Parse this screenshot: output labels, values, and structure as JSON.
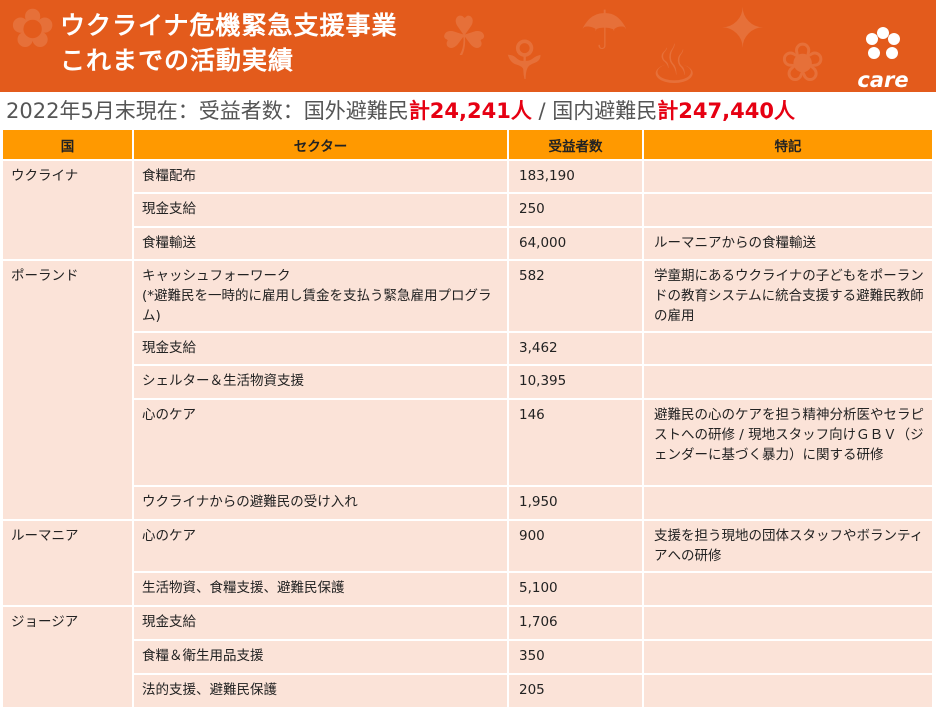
{
  "header": {
    "title_line1": "ウクライナ危機緊急支援事業",
    "title_line2": "これまでの活動実績",
    "logo_text": "care"
  },
  "summary": {
    "prefix": "2022年5月末現在：受益者数：国外避難民",
    "overseas_total": "計24,241人",
    "separator": " / 国内避難民",
    "domestic_total": "計247,440人"
  },
  "table": {
    "headers": [
      "国",
      "セクター",
      "受益者数",
      "特記"
    ],
    "countries": [
      {
        "name": "ウクライナ",
        "rows": [
          {
            "sector": "食糧配布",
            "count": "183,190",
            "note": ""
          },
          {
            "sector": "現金支給",
            "count": "250",
            "note": ""
          },
          {
            "sector": "食糧輸送",
            "count": "64,000",
            "note": "ルーマニアからの食糧輸送"
          }
        ]
      },
      {
        "name": "ポーランド",
        "rows": [
          {
            "sector": "キャッシュフォーワーク\n(*避難民を一時的に雇用し賃金を支払う緊急雇用プログラム)",
            "count": "582",
            "note": "学童期にあるウクライナの子どもをポーランドの教育システムに統合支援する避難民教師の雇用"
          },
          {
            "sector": "現金支給",
            "count": "3,462",
            "note": ""
          },
          {
            "sector": "シェルター＆生活物資支援",
            "count": "10,395",
            "note": ""
          },
          {
            "sector": "心のケア",
            "count": "146",
            "note": "避難民の心のケアを担う精神分析医やセラピストへの研修 / 現地スタッフ向けＧＢＶ（ジェンダーに基づく暴力）に関する研修"
          },
          {
            "sector": "ウクライナからの避難民の受け入れ",
            "count": "1,950",
            "note": ""
          }
        ]
      },
      {
        "name": "ルーマニア",
        "rows": [
          {
            "sector": "心のケア",
            "count": "900",
            "note": "支援を担う現地の団体スタッフやボランティアへの研修"
          },
          {
            "sector": "生活物資、食糧支援、避難民保護",
            "count": "5,100",
            "note": ""
          }
        ]
      },
      {
        "name": "ジョージア",
        "rows": [
          {
            "sector": "現金支給",
            "count": "1,706",
            "note": ""
          },
          {
            "sector": "食糧＆衛生用品支援",
            "count": "350",
            "note": ""
          },
          {
            "sector": "法的支援、避難民保護",
            "count": "205",
            "note": ""
          }
        ]
      }
    ]
  },
  "colors": {
    "banner": "#e35b1c",
    "header_row": "#ff9900",
    "cell": "#fbe3d8",
    "highlight": "#e60012"
  }
}
